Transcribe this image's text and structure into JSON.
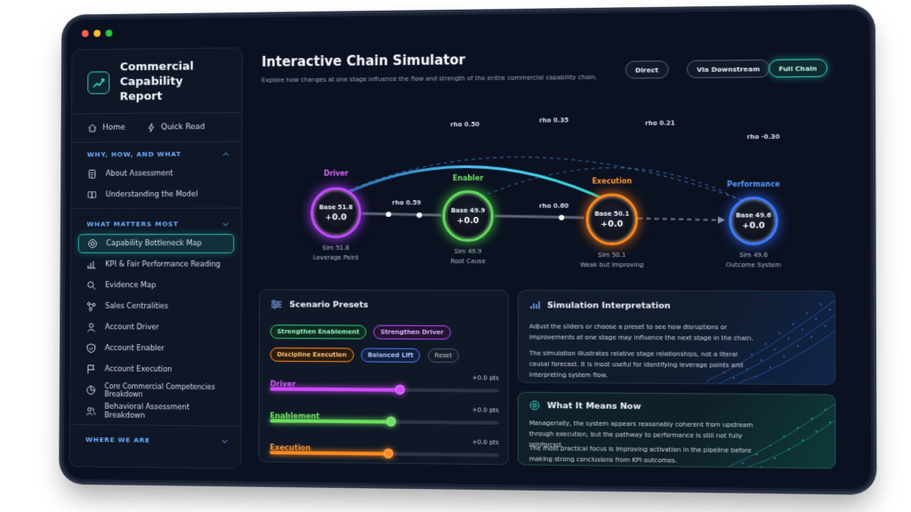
{
  "sidebar": {
    "brand_title": "Commercial Capability Report",
    "home_label": "Home",
    "quick_read_label": "Quick Read",
    "section1_title": "WHY, HOW, AND WHAT",
    "section1_items": [
      "About Assessment",
      "Understanding the Model"
    ],
    "section2_title": "WHAT MATTERS MOST",
    "section2_items": [
      "Capability Bottleneck Map",
      "KPI & Fair Performance Reading",
      "Evidence Map",
      "Sales Centralities",
      "Account Driver",
      "Account Enabler",
      "Account Execution",
      "Core Commercial Competencies Breakdown",
      "Behavioral Assessment Breakdown"
    ],
    "section3_title": "WHERE WE ARE"
  },
  "main": {
    "title": "Interactive Chain Simulator",
    "subtitle": "Explore how changes at one stage influence the flow and strength of the entire commercial capability chain.",
    "modes": [
      "Direct",
      "Via Downstream",
      "Full Chain"
    ],
    "active_mode": "Full Chain"
  },
  "chain": {
    "nodes": [
      {
        "name": "Driver",
        "base": "Base 51.8",
        "delta": "+0.0",
        "sim": "Sim 51.8",
        "role": "Leverage Point",
        "color": "#c64bff"
      },
      {
        "name": "Enabler",
        "base": "Base 49.9",
        "delta": "+0.0",
        "sim": "Sim 49.9",
        "role": "Root Cause",
        "color": "#5fe05a"
      },
      {
        "name": "Execution",
        "base": "Base 50.1",
        "delta": "+0.0",
        "sim": "Sim 50.1",
        "role": "Weak but Improving",
        "color": "#ff8a1f"
      },
      {
        "name": "Performance",
        "base": "Base 49.6",
        "delta": "+0.0",
        "sim": "Sim 49.6",
        "role": "Outcome System",
        "color": "#3d7dff"
      }
    ],
    "rho_driver_enabler": "rho 0.59",
    "rho_enabler_execution": "rho 0.60",
    "rho_arc_main": "rho 0.50",
    "rho_arc_1": "rho 0.35",
    "rho_arc_2": "rho 0.21",
    "rho_arc_3": "rho -0.30"
  },
  "presets": {
    "title": "Scenario Presets",
    "chips": [
      "Strengthen Enablement",
      "Strengthen Driver",
      "Discipline Execution",
      "Balanced Lift",
      "Reset"
    ],
    "sliders": [
      {
        "label": "Driver",
        "value": "+0.0 pts",
        "level": 0.57,
        "color": "#d04bff"
      },
      {
        "label": "Enablement",
        "value": "+0.0 pts",
        "level": 0.53,
        "color": "#6be05e"
      },
      {
        "label": "Execution",
        "value": "+0.0 pts",
        "level": 0.52,
        "color": "#ff8a1f"
      }
    ]
  },
  "interpretation": {
    "title": "Simulation Interpretation",
    "p1": "Adjust the sliders or choose a preset to see how disruptions or improvements at one stage may influence the next stage in the chain.",
    "p2": "The simulation illustrates relative stage relationships, not a literal causal forecast. It is most useful for identifying leverage points and interpreting system flow."
  },
  "meaning": {
    "title": "What It Means Now",
    "p1": "Managerially, the system appears reasonably coherent from upstream through execution, but the pathway to performance is still not fully reinforced.",
    "p2": "The most practical focus is improving activation in the pipeline before making strong conclusions from KPI outcomes."
  }
}
